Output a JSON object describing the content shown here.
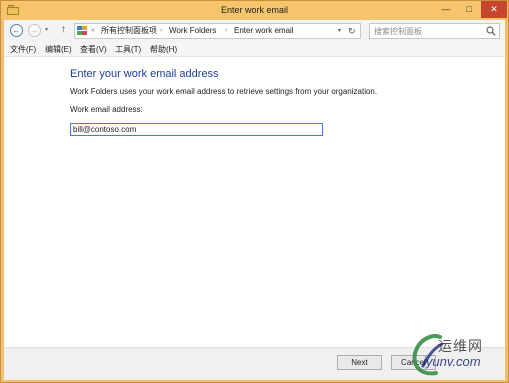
{
  "window": {
    "title": "Enter work email"
  },
  "title_buttons": {
    "minimize": "—",
    "maximize": "□",
    "close": "✕"
  },
  "address_bar": {
    "back_glyph": "←",
    "forward_glyph": "→",
    "up_glyph": "↑",
    "dropdown_glyph": "▾",
    "refresh_glyph": "↻",
    "overflow_glyph": "«",
    "breadcrumbs": [
      "所有控制面板项",
      "Work Folders",
      "Enter work email"
    ],
    "separator": "›",
    "search_placeholder": "搜索控制面板"
  },
  "menu": {
    "items": [
      "文件(F)",
      "编辑(E)",
      "查看(V)",
      "工具(T)",
      "帮助(H)"
    ]
  },
  "main": {
    "heading": "Enter your work email address",
    "description": "Work Folders uses your work email address to retrieve settings from your organization.",
    "field_label": "Work email address:",
    "email_value": "bill@contoso.com"
  },
  "footer": {
    "next_label": "Next",
    "cancel_label": "Cancel"
  },
  "watermark": {
    "text_cn": "运维网",
    "url": "iyunv.com"
  },
  "icons": {
    "app": "folder-icon",
    "location": "control-panel-icon",
    "search": "search-icon"
  },
  "colors": {
    "title_bar": "#f6c46a",
    "heading": "#1c3f94",
    "input_focus_border": "#3c7fd6",
    "close_button": "#c7452f"
  }
}
